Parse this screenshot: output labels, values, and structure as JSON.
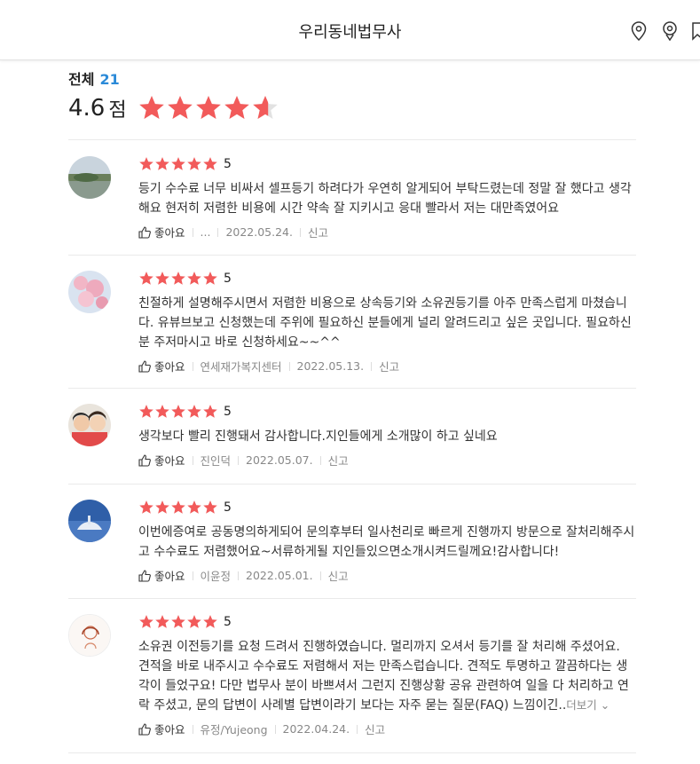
{
  "header": {
    "title": "우리동네법무사"
  },
  "summary": {
    "total_label": "전체",
    "total_count": "21",
    "score": "4.6",
    "score_unit": "점",
    "rating": 4.6
  },
  "colors": {
    "star": "#f25a5a",
    "accent": "#2b8ad8"
  },
  "reviews": [
    {
      "rating": "5",
      "text": "등기 수수료 너무 비싸서 셀프등기  하려다가 우연히 알게되어 부탁드렸는데 정말 잘 했다고 생각해요 현저히 저렴한 비용에 시간 약속 잘 지키시고 응대 빨라서 저는 대만족였어요",
      "like_label": "좋아요",
      "author": "...",
      "date": "2022.05.24.",
      "report": "신고"
    },
    {
      "rating": "5",
      "text": "친절하게 설명해주시면서 저렴한 비용으로 상속등기와 소유권등기를 아주 만족스럽게 마쳤습니다. 유뷰브보고 신청했는데 주위에 필요하신 분들에게 널리 알려드리고 싶은 곳입니다. 필요하신분 주저마시고 바로 신청하세요~~^^",
      "like_label": "좋아요",
      "author": "연세재가복지센터",
      "date": "2022.05.13.",
      "report": "신고"
    },
    {
      "rating": "5",
      "text": "생각보다 빨리 진행돼서 감사합니다.지인들에게 소개많이 하고 싶네요",
      "like_label": "좋아요",
      "author": "진인덕",
      "date": "2022.05.07.",
      "report": "신고"
    },
    {
      "rating": "5",
      "text": "이번에증여로 공동명의하게되어 문의후부터 일사천리로 빠르게 진행까지 방문으로 잘처리해주시고 수수료도 저렴했어요~서류하게될 지인들있으면소개시켜드릴께요!감사합니다!",
      "like_label": "좋아요",
      "author": "이윤정",
      "date": "2022.05.01.",
      "report": "신고"
    },
    {
      "rating": "5",
      "text": "소유권 이전등기를 요청 드려서 진행하였습니다. 멀리까지 오셔서 등기를 잘 처리해 주셨어요. 견적을 바로 내주시고 수수료도 저렴해서 저는 만족스럽습니다. 견적도 투명하고 깔끔하다는 생각이 들었구요!  다만 법무사 분이 바쁘셔서 그런지 진행상황 공유 관련하여 일을 다 처리하고 연락 주셨고, 문의 답변이 사례별 답변이라기 보다는 자주 묻는 질문(FAQ) 느낌이긴..",
      "more_label": "더보기",
      "like_label": "좋아요",
      "author": "유정/Yujeong",
      "date": "2022.04.24.",
      "report": "신고"
    }
  ]
}
